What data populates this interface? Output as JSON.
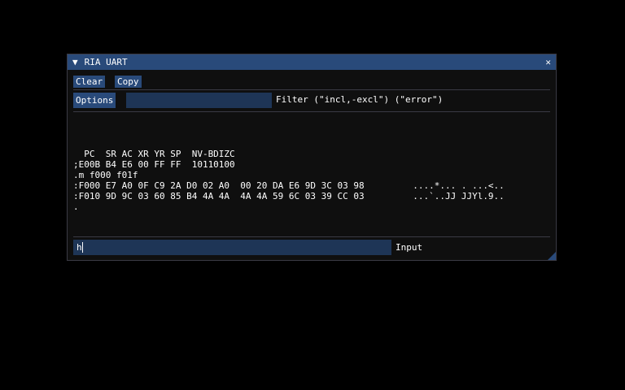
{
  "window": {
    "title": "RIA UART",
    "collapse_icon": "▼",
    "close_icon": "✕"
  },
  "toolbar": {
    "clear": "Clear",
    "copy": "Copy",
    "options": "Options",
    "filter_value": "",
    "filter_label": "Filter (\"incl,-excl\") (\"error\")"
  },
  "log": [
    "",
    "  PC  SR AC XR YR SP  NV-BDIZC",
    ";E00B B4 E6 00 FF FF  10110100",
    ".m f000 f01f",
    ":F000 E7 A0 0F C9 2A D0 02 A0  00 20 DA E6 9D 3C 03 98         ....*... . ...<..",
    ":F010 9D 9C 03 60 85 B4 4A 4A  4A 4A 59 6C 03 39 CC 03         ...`..JJ JJYl.9..",
    "."
  ],
  "input": {
    "value": "h",
    "label": "Input"
  }
}
